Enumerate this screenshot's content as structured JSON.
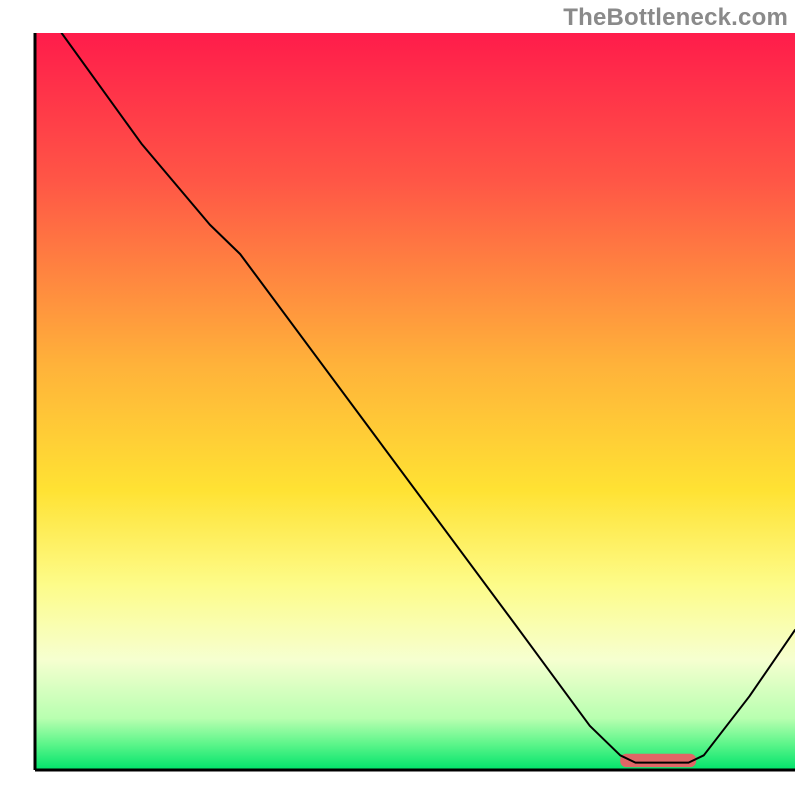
{
  "watermark": "TheBottleneck.com",
  "chart_data": {
    "type": "line",
    "title": "",
    "xlabel": "",
    "ylabel": "",
    "xlim": [
      0,
      100
    ],
    "ylim": [
      0,
      100
    ],
    "grid": false,
    "legend": false,
    "annotations": [],
    "background": {
      "type": "vertical-gradient",
      "description": "red at top through orange, yellow, pale yellow, to green at bottom",
      "stops": [
        {
          "pos": 0.0,
          "color": "#ff1c4b"
        },
        {
          "pos": 0.2,
          "color": "#ff5646"
        },
        {
          "pos": 0.45,
          "color": "#ffb23a"
        },
        {
          "pos": 0.62,
          "color": "#ffe233"
        },
        {
          "pos": 0.75,
          "color": "#fdfc8a"
        },
        {
          "pos": 0.85,
          "color": "#f6ffd0"
        },
        {
          "pos": 0.93,
          "color": "#b8ffb0"
        },
        {
          "pos": 0.965,
          "color": "#5cf58a"
        },
        {
          "pos": 1.0,
          "color": "#00e36b"
        }
      ]
    },
    "curve": {
      "color": "#000000",
      "width": 2,
      "points_xy": [
        [
          3.5,
          100.0
        ],
        [
          14.0,
          85.0
        ],
        [
          23.0,
          74.0
        ],
        [
          27.0,
          70.0
        ],
        [
          45.0,
          45.0
        ],
        [
          63.0,
          20.0
        ],
        [
          73.0,
          6.0
        ],
        [
          77.0,
          2.0
        ],
        [
          79.0,
          1.0
        ],
        [
          86.0,
          1.0
        ],
        [
          88.0,
          2.0
        ],
        [
          94.0,
          10.0
        ],
        [
          100.0,
          19.0
        ]
      ]
    },
    "marker_bar": {
      "color": "#e06666",
      "x_start": 77.0,
      "x_end": 87.0,
      "y": 1.3,
      "thickness_frac": 0.018
    },
    "frame": {
      "visible_edges": [
        "left",
        "bottom"
      ],
      "color": "#000000",
      "width": 3
    }
  }
}
